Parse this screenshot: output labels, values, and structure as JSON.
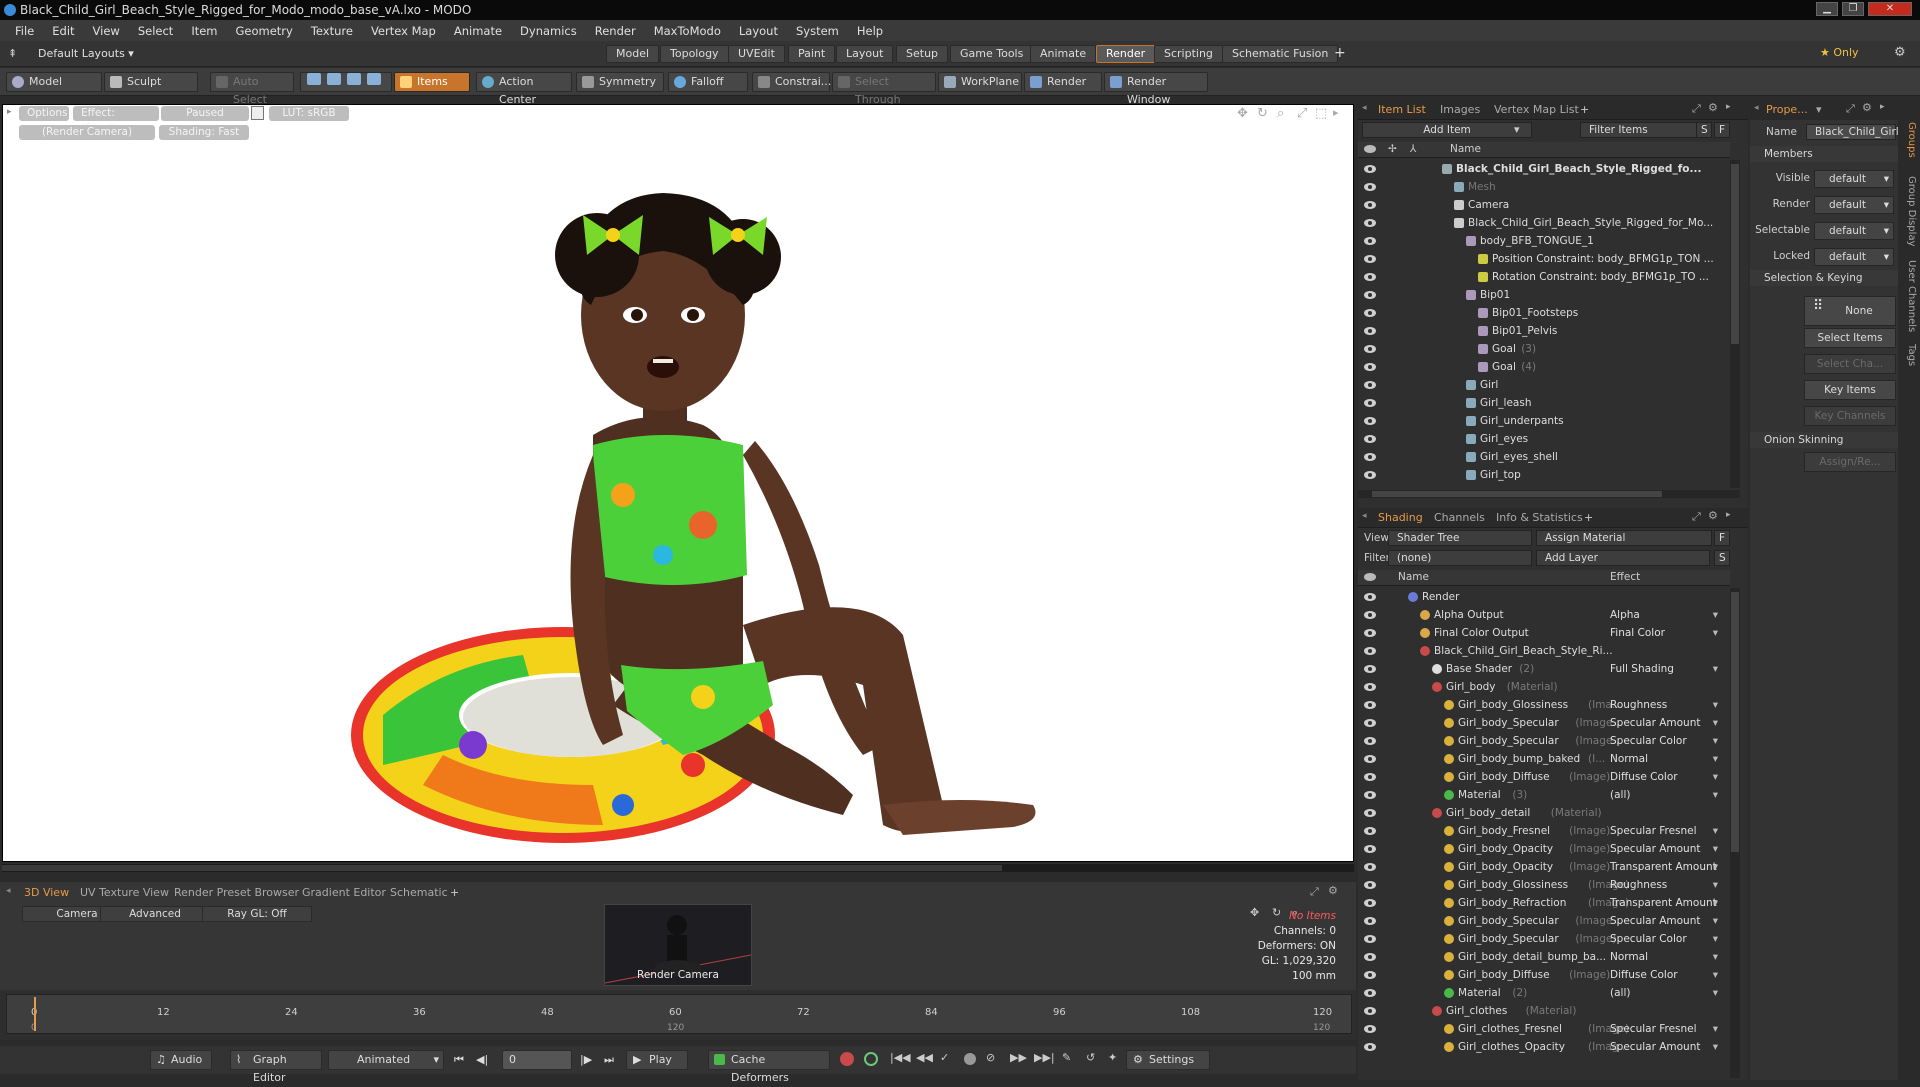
{
  "window": {
    "title": "Black_Child_Girl_Beach_Style_Rigged_for_Modo_modo_base_vA.lxo - MODO",
    "min": "▁",
    "max": "❐",
    "close": "✕"
  },
  "menu": [
    "File",
    "Edit",
    "View",
    "Select",
    "Item",
    "Geometry",
    "Texture",
    "Vertex Map",
    "Animate",
    "Dynamics",
    "Render",
    "MaxToModo",
    "Layout",
    "System",
    "Help"
  ],
  "layoutbar": {
    "layout": "Default Layouts ▾",
    "tabs": [
      "Model",
      "Topology",
      "UVEdit",
      "Paint",
      "Layout",
      "Setup",
      "Game Tools",
      "Animate",
      "Render",
      "Scripting",
      "Schematic Fusion"
    ],
    "active": "Render",
    "add": "+",
    "only": "★  Only"
  },
  "toolbar": {
    "model": "Model",
    "sculpt": "Sculpt",
    "auto_select": "Auto Select",
    "items": "Items",
    "action_center": "Action Center",
    "symmetry": "Symmetry",
    "falloff": "Falloff",
    "constraints": "Constrai...",
    "select_through": "Select Through",
    "workplane": "WorkPlane",
    "render": "Render",
    "render_window": "Render Window"
  },
  "viewport": {
    "chips_row1": [
      "Options",
      "Effect: (Shadi...",
      "Paused",
      "LUT: sRGB"
    ],
    "chips_row2": [
      "(Render Camera)",
      "Shading: Fast"
    ]
  },
  "bottom": {
    "tabs": [
      "3D View",
      "UV Texture View",
      "Render Preset Browser",
      "Gradient Editor",
      "Schematic"
    ],
    "active": "3D View",
    "add": "+",
    "buttons": [
      "Camera",
      "Advanced",
      "Ray GL: Off"
    ],
    "preview_label": "Render Camera",
    "stats": [
      "No Items",
      "Channels: 0",
      "Deformers: ON",
      "GL: 1,029,320",
      "100 mm"
    ]
  },
  "timeline": {
    "ticks": [
      "0",
      "12",
      "24",
      "36",
      "48",
      "60",
      "72",
      "84",
      "96",
      "108",
      "120"
    ],
    "sub_ticks": [
      "0",
      "120",
      "120"
    ]
  },
  "transport": {
    "audio": "Audio",
    "graph_editor": "Graph Editor",
    "animated": "Animated",
    "frame": "0",
    "play": "Play",
    "cache": "Cache Deformers",
    "settings": "Settings"
  },
  "itemlist": {
    "tabs": [
      "Item List",
      "Images",
      "Vertex Map List"
    ],
    "active": "Item List",
    "add_item": "Add Item",
    "filter": "Filter Items",
    "s": "S",
    "f": "F",
    "col_name": "Name",
    "rows": [
      {
        "indent": 0,
        "name": "Black_Child_Girl_Beach_Style_Rigged_fo...",
        "sub": "",
        "bold": true,
        "icon": "#9aa"
      },
      {
        "indent": 1,
        "name": "Mesh",
        "sub": "",
        "dim": true,
        "icon": "#8ab"
      },
      {
        "indent": 1,
        "name": "Camera",
        "sub": "",
        "icon": "#ccc"
      },
      {
        "indent": 1,
        "name": "Black_Child_Girl_Beach_Style_Rigged_for_Mo...",
        "sub": "",
        "icon": "#ccc"
      },
      {
        "indent": 2,
        "name": "body_BFB_TONGUE_1",
        "sub": "",
        "icon": "#a9b"
      },
      {
        "indent": 3,
        "name": "Position Constraint: body_BFMG1p_TON ...",
        "sub": "",
        "icon": "#cc4"
      },
      {
        "indent": 3,
        "name": "Rotation Constraint: body_BFMG1p_TO ...",
        "sub": "",
        "icon": "#cc4"
      },
      {
        "indent": 2,
        "name": "Bip01",
        "sub": "",
        "icon": "#a9b"
      },
      {
        "indent": 3,
        "name": "Bip01_Footsteps",
        "sub": "",
        "icon": "#a9b"
      },
      {
        "indent": 3,
        "name": "Bip01_Pelvis",
        "sub": "",
        "icon": "#a9b"
      },
      {
        "indent": 3,
        "name": "Goal",
        "sub": "(3)",
        "icon": "#a9b"
      },
      {
        "indent": 3,
        "name": "Goal",
        "sub": "(4)",
        "icon": "#a9b"
      },
      {
        "indent": 2,
        "name": "Girl",
        "sub": "",
        "icon": "#8ab"
      },
      {
        "indent": 2,
        "name": "Girl_leash",
        "sub": "",
        "icon": "#8ab"
      },
      {
        "indent": 2,
        "name": "Girl_underpants",
        "sub": "",
        "icon": "#8ab"
      },
      {
        "indent": 2,
        "name": "Girl_eyes",
        "sub": "",
        "icon": "#8ab"
      },
      {
        "indent": 2,
        "name": "Girl_eyes_shell",
        "sub": "",
        "icon": "#8ab"
      },
      {
        "indent": 2,
        "name": "Girl_top",
        "sub": "",
        "icon": "#8ab"
      }
    ]
  },
  "shading": {
    "tabs": [
      "Shading",
      "Channels",
      "Info & Statistics"
    ],
    "active": "Shading",
    "view_label": "View",
    "view_value": "Shader Tree",
    "assign": "Assign Material",
    "filter_label": "Filter",
    "filter_value": "(none)",
    "add_layer": "Add Layer",
    "col_name": "Name",
    "col_effect": "Effect",
    "rows": [
      {
        "indent": 0,
        "name": "Render",
        "sub": "",
        "effect": "",
        "icon": "#6a7ad8"
      },
      {
        "indent": 1,
        "name": "Alpha Output",
        "sub": "",
        "effect": "Alpha",
        "icon": "#d8a84a"
      },
      {
        "indent": 1,
        "name": "Final Color Output",
        "sub": "",
        "effect": "Final Color",
        "icon": "#d8a84a"
      },
      {
        "indent": 1,
        "name": "Black_Child_Girl_Beach_Style_Ri...",
        "sub": "",
        "effect": "",
        "icon": "#c84a4a"
      },
      {
        "indent": 2,
        "name": "Base Shader",
        "sub": "(2)",
        "effect": "Full Shading",
        "icon": "#dddddd"
      },
      {
        "indent": 2,
        "name": "Girl_body",
        "sub": "(Material)",
        "effect": "",
        "icon": "#c84a4a"
      },
      {
        "indent": 3,
        "name": "Girl_body_Glossiness",
        "sub": "(Ima...",
        "effect": "Roughness",
        "icon": "#d8b23a"
      },
      {
        "indent": 3,
        "name": "Girl_body_Specular",
        "sub": "(Image...",
        "effect": "Specular Amount",
        "icon": "#d8b23a"
      },
      {
        "indent": 3,
        "name": "Girl_body_Specular",
        "sub": "(Image...",
        "effect": "Specular Color",
        "icon": "#d8b23a"
      },
      {
        "indent": 3,
        "name": "Girl_body_bump_baked",
        "sub": "(I...",
        "effect": "Normal",
        "icon": "#d8b23a"
      },
      {
        "indent": 3,
        "name": "Girl_body_Diffuse",
        "sub": "(Image)",
        "effect": "Diffuse Color",
        "icon": "#d8b23a"
      },
      {
        "indent": 3,
        "name": "Material",
        "sub": "(3)",
        "effect": "(all)",
        "icon": "#4ab84a"
      },
      {
        "indent": 2,
        "name": "Girl_body_detail",
        "sub": "(Material)",
        "effect": "",
        "icon": "#c84a4a"
      },
      {
        "indent": 3,
        "name": "Girl_body_Fresnel",
        "sub": "(Image)",
        "effect": "Specular Fresnel",
        "icon": "#d8b23a"
      },
      {
        "indent": 3,
        "name": "Girl_body_Opacity",
        "sub": "(Image)...",
        "effect": "Specular Amount",
        "icon": "#d8b23a"
      },
      {
        "indent": 3,
        "name": "Girl_body_Opacity",
        "sub": "(Image)",
        "effect": "Transparent Amount",
        "icon": "#d8b23a"
      },
      {
        "indent": 3,
        "name": "Girl_body_Glossiness",
        "sub": "(Image)",
        "effect": "Roughness",
        "icon": "#d8b23a"
      },
      {
        "indent": 3,
        "name": "Girl_body_Refraction",
        "sub": "(Image)",
        "effect": "Transparent Amount",
        "icon": "#d8b23a"
      },
      {
        "indent": 3,
        "name": "Girl_body_Specular",
        "sub": "(Image...",
        "effect": "Specular Amount",
        "icon": "#d8b23a"
      },
      {
        "indent": 3,
        "name": "Girl_body_Specular",
        "sub": "(Image)",
        "effect": "Specular Color",
        "icon": "#d8b23a"
      },
      {
        "indent": 3,
        "name": "Girl_body_detail_bump_ba...",
        "sub": "",
        "effect": "Normal",
        "icon": "#d8b23a"
      },
      {
        "indent": 3,
        "name": "Girl_body_Diffuse",
        "sub": "(Image)",
        "effect": "Diffuse Color",
        "icon": "#d8b23a"
      },
      {
        "indent": 3,
        "name": "Material",
        "sub": "(2)",
        "effect": "(all)",
        "icon": "#4ab84a"
      },
      {
        "indent": 2,
        "name": "Girl_clothes",
        "sub": "(Material)",
        "effect": "",
        "icon": "#c84a4a"
      },
      {
        "indent": 3,
        "name": "Girl_clothes_Fresnel",
        "sub": "(Image)",
        "effect": "Specular Fresnel",
        "icon": "#d8b23a"
      },
      {
        "indent": 3,
        "name": "Girl_clothes_Opacity",
        "sub": "(Imag...",
        "effect": "Specular Amount",
        "icon": "#d8b23a"
      }
    ]
  },
  "properties": {
    "tab": "Prope...",
    "name_label": "Name",
    "name_value": "Black_Child_Girl_",
    "members": "Members",
    "visible_label": "Visible",
    "visible_value": "default",
    "render_label": "Render",
    "render_value": "default",
    "selectable_label": "Selectable",
    "selectable_value": "default",
    "locked_label": "Locked",
    "locked_value": "default",
    "sel_keying": "Selection & Keying",
    "none": "None",
    "select_items": "Select Items",
    "select_channels": "Select Cha...",
    "key_items": "Key Items",
    "key_channels": "Key Channels",
    "onion": "Onion Skinning",
    "assign_remove": "Assign/Re..."
  },
  "side_tabs": [
    "Groups",
    "Group Display",
    "User Channels",
    "Tags"
  ],
  "colors": {
    "accent": "#e79a47",
    "active_tab_border": "#c8742a"
  }
}
